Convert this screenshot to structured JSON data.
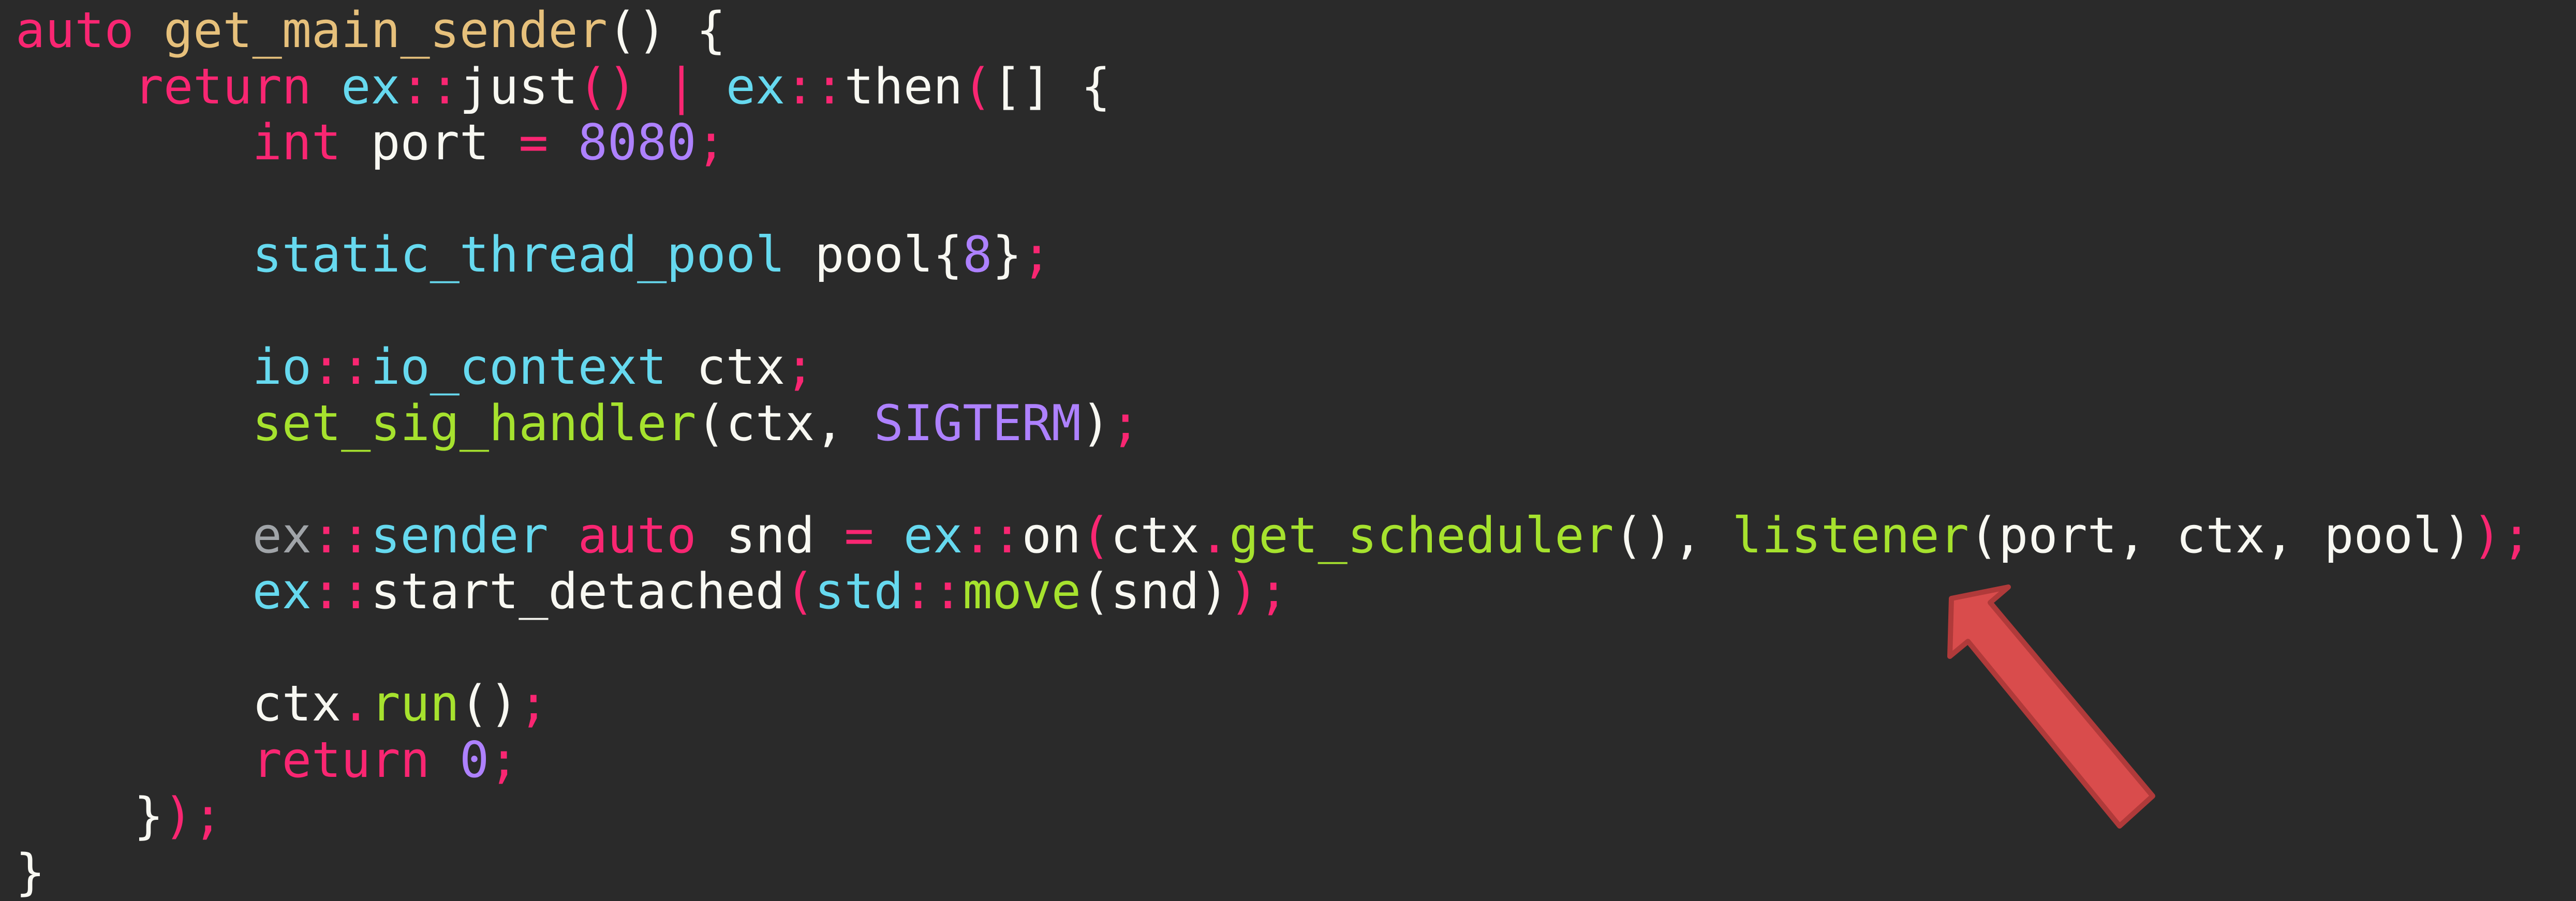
{
  "colors": {
    "background": "#2a2a2a",
    "arrow": "#d94c4c",
    "arrow_outline": "#b03a3a"
  },
  "editor": {
    "lines": [
      {
        "tokens": [
          {
            "text": "auto",
            "color": "#f92672"
          },
          {
            "text": " ",
            "color": "#f8f8f2"
          },
          {
            "text": "get_main_sender",
            "color": "#e6c07b"
          },
          {
            "text": "() {",
            "color": "#f8f8f2"
          }
        ]
      },
      {
        "tokens": [
          {
            "text": "    ",
            "color": "#f8f8f2"
          },
          {
            "text": "return",
            "color": "#f92672"
          },
          {
            "text": " ",
            "color": "#f8f8f2"
          },
          {
            "text": "ex",
            "color": "#66d9ef"
          },
          {
            "text": "::",
            "color": "#f92672"
          },
          {
            "text": "just",
            "color": "#f8f8f2"
          },
          {
            "text": "()",
            "color": "#f92672"
          },
          {
            "text": " | ",
            "color": "#f92672"
          },
          {
            "text": "ex",
            "color": "#66d9ef"
          },
          {
            "text": "::",
            "color": "#f92672"
          },
          {
            "text": "then",
            "color": "#f8f8f2"
          },
          {
            "text": "(",
            "color": "#f92672"
          },
          {
            "text": "[] {",
            "color": "#f8f8f2"
          }
        ]
      },
      {
        "tokens": [
          {
            "text": "        ",
            "color": "#f8f8f2"
          },
          {
            "text": "int",
            "color": "#f92672"
          },
          {
            "text": " port ",
            "color": "#f8f8f2"
          },
          {
            "text": "=",
            "color": "#f92672"
          },
          {
            "text": " ",
            "color": "#f8f8f2"
          },
          {
            "text": "8080",
            "color": "#ae81ff"
          },
          {
            "text": ";",
            "color": "#f92672"
          }
        ]
      },
      {
        "tokens": [
          {
            "text": "",
            "color": "#f8f8f2"
          }
        ]
      },
      {
        "tokens": [
          {
            "text": "        ",
            "color": "#f8f8f2"
          },
          {
            "text": "static_thread_pool",
            "color": "#66d9ef"
          },
          {
            "text": " pool{",
            "color": "#f8f8f2"
          },
          {
            "text": "8",
            "color": "#ae81ff"
          },
          {
            "text": "}",
            "color": "#f8f8f2"
          },
          {
            "text": ";",
            "color": "#f92672"
          }
        ]
      },
      {
        "tokens": [
          {
            "text": "",
            "color": "#f8f8f2"
          }
        ]
      },
      {
        "tokens": [
          {
            "text": "        ",
            "color": "#f8f8f2"
          },
          {
            "text": "io",
            "color": "#66d9ef"
          },
          {
            "text": "::",
            "color": "#f92672"
          },
          {
            "text": "io_context",
            "color": "#66d9ef"
          },
          {
            "text": " ctx",
            "color": "#f8f8f2"
          },
          {
            "text": ";",
            "color": "#f92672"
          }
        ]
      },
      {
        "tokens": [
          {
            "text": "        ",
            "color": "#f8f8f2"
          },
          {
            "text": "set_sig_handler",
            "color": "#a6e22e"
          },
          {
            "text": "(ctx, ",
            "color": "#f8f8f2"
          },
          {
            "text": "SIGTERM",
            "color": "#ae81ff"
          },
          {
            "text": ")",
            "color": "#f8f8f2"
          },
          {
            "text": ";",
            "color": "#f92672"
          }
        ]
      },
      {
        "tokens": [
          {
            "text": "",
            "color": "#f8f8f2"
          }
        ]
      },
      {
        "tokens": [
          {
            "text": "        ",
            "color": "#f8f8f2"
          },
          {
            "text": "ex",
            "color": "#a0a4a8"
          },
          {
            "text": "::",
            "color": "#f92672"
          },
          {
            "text": "sender",
            "color": "#66d9ef"
          },
          {
            "text": " ",
            "color": "#f8f8f2"
          },
          {
            "text": "auto",
            "color": "#f92672"
          },
          {
            "text": " snd ",
            "color": "#f8f8f2"
          },
          {
            "text": "=",
            "color": "#f92672"
          },
          {
            "text": " ",
            "color": "#f8f8f2"
          },
          {
            "text": "ex",
            "color": "#66d9ef"
          },
          {
            "text": "::",
            "color": "#f92672"
          },
          {
            "text": "on",
            "color": "#f8f8f2"
          },
          {
            "text": "(",
            "color": "#f92672"
          },
          {
            "text": "ctx",
            "color": "#f8f8f2"
          },
          {
            "text": ".",
            "color": "#f92672"
          },
          {
            "text": "get_scheduler",
            "color": "#a6e22e"
          },
          {
            "text": "(), ",
            "color": "#f8f8f2"
          },
          {
            "text": "listener",
            "color": "#a6e22e"
          },
          {
            "text": "(port, ctx, pool)",
            "color": "#f8f8f2"
          },
          {
            "text": ");",
            "color": "#f92672"
          }
        ]
      },
      {
        "tokens": [
          {
            "text": "        ",
            "color": "#f8f8f2"
          },
          {
            "text": "ex",
            "color": "#66d9ef"
          },
          {
            "text": "::",
            "color": "#f92672"
          },
          {
            "text": "start_detached",
            "color": "#f8f8f2"
          },
          {
            "text": "(",
            "color": "#f92672"
          },
          {
            "text": "std",
            "color": "#66d9ef"
          },
          {
            "text": "::",
            "color": "#f92672"
          },
          {
            "text": "move",
            "color": "#a6e22e"
          },
          {
            "text": "(snd)",
            "color": "#f8f8f2"
          },
          {
            "text": ");",
            "color": "#f92672"
          }
        ]
      },
      {
        "tokens": [
          {
            "text": "",
            "color": "#f8f8f2"
          }
        ]
      },
      {
        "tokens": [
          {
            "text": "        ",
            "color": "#f8f8f2"
          },
          {
            "text": "ctx",
            "color": "#f8f8f2"
          },
          {
            "text": ".",
            "color": "#f92672"
          },
          {
            "text": "run",
            "color": "#a6e22e"
          },
          {
            "text": "()",
            "color": "#f8f8f2"
          },
          {
            "text": ";",
            "color": "#f92672"
          }
        ]
      },
      {
        "tokens": [
          {
            "text": "        ",
            "color": "#f8f8f2"
          },
          {
            "text": "return",
            "color": "#f92672"
          },
          {
            "text": " ",
            "color": "#f8f8f2"
          },
          {
            "text": "0",
            "color": "#ae81ff"
          },
          {
            "text": ";",
            "color": "#f92672"
          }
        ]
      },
      {
        "tokens": [
          {
            "text": "    ",
            "color": "#f8f8f2"
          },
          {
            "text": "}",
            "color": "#f8f8f2"
          },
          {
            "text": ");",
            "color": "#f92672"
          }
        ]
      },
      {
        "tokens": [
          {
            "text": "}",
            "color": "#f8f8f2"
          }
        ]
      }
    ]
  }
}
